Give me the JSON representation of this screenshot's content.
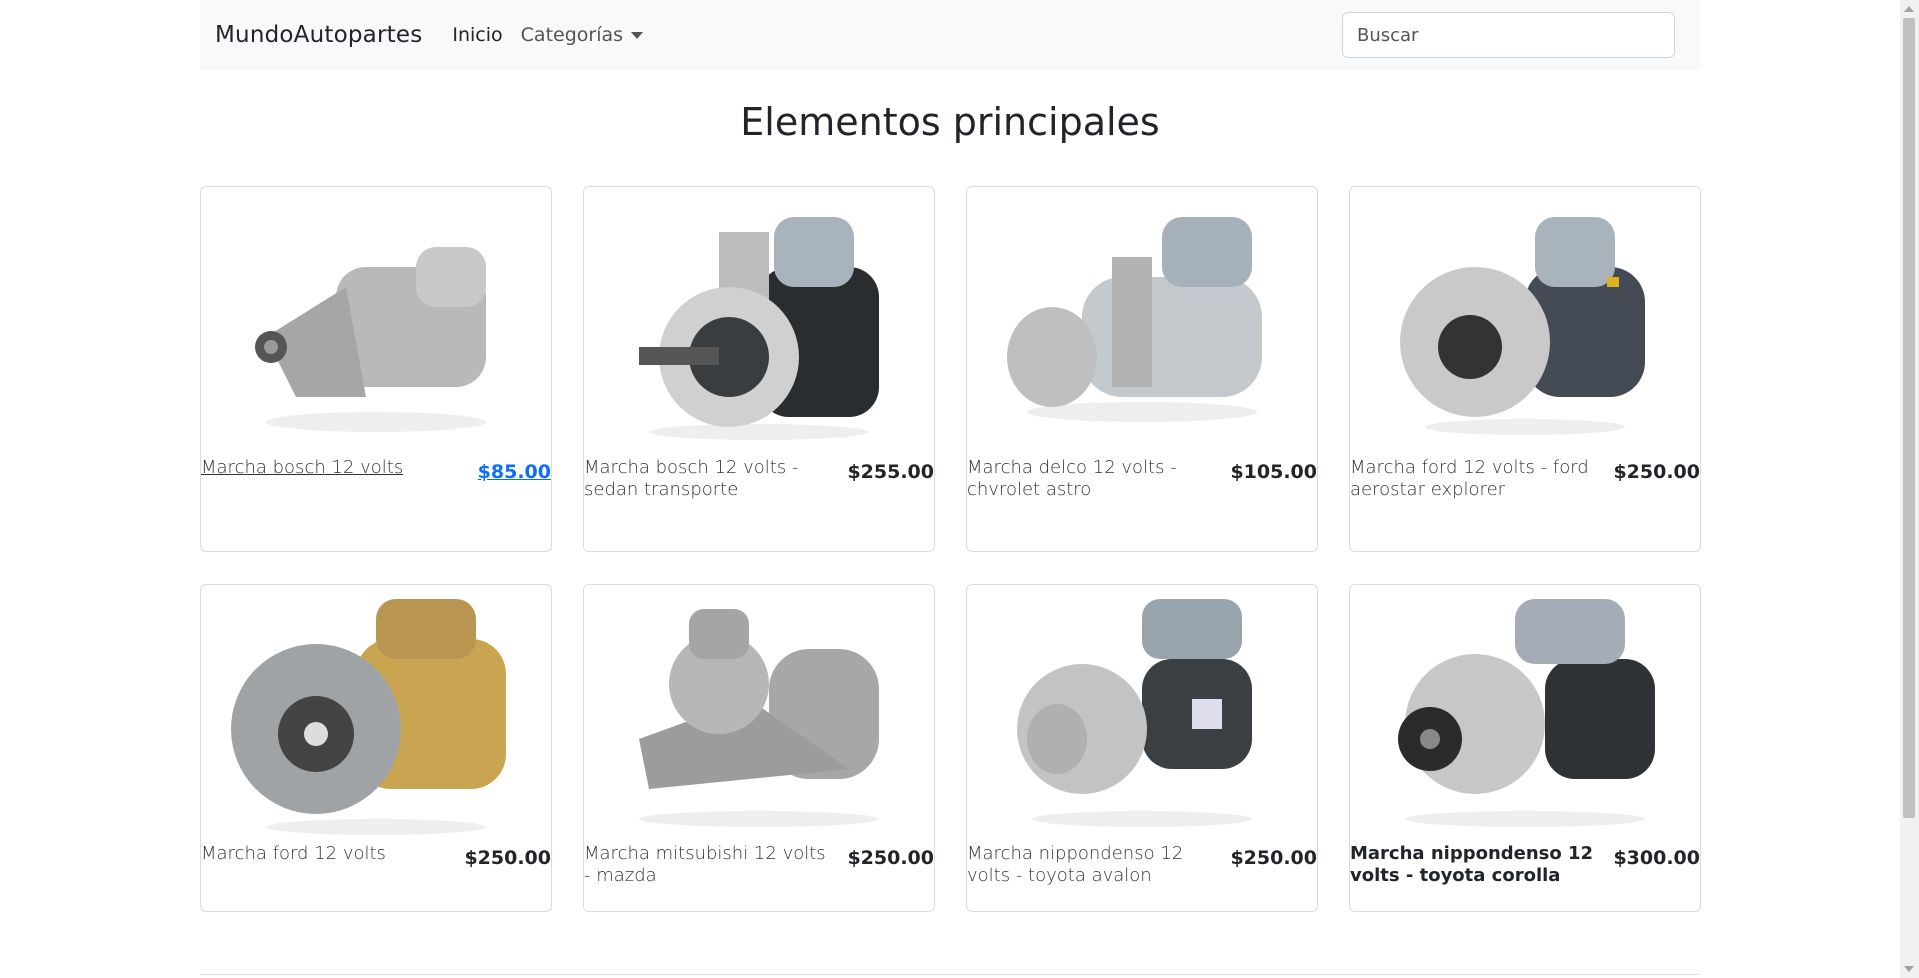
{
  "navbar": {
    "brand": "MundoAutopartes",
    "links": [
      "Inicio",
      "Categorías"
    ],
    "search_placeholder": "Buscar"
  },
  "page": {
    "title": "Elementos principales"
  },
  "products": [
    {
      "name": "Marcha bosch 12 volts",
      "price": "$85.00"
    },
    {
      "name": "Marcha bosch 12 volts - sedan transporte",
      "price": "$255.00"
    },
    {
      "name": "Marcha delco 12 volts - chvrolet astro",
      "price": "$105.00"
    },
    {
      "name": "Marcha ford 12 volts - ford aerostar explorer",
      "price": "$250.00"
    },
    {
      "name": "Marcha ford 12 volts",
      "price": "$250.00"
    },
    {
      "name": "Marcha mitsubishi 12 volts - mazda",
      "price": "$250.00"
    },
    {
      "name": "Marcha nippondenso 12 volts - toyota avalon",
      "price": "$250.00"
    },
    {
      "name": "Marcha nippondenso 12 volts - toyota corolla",
      "price": "$300.00"
    }
  ],
  "colors": {
    "link": "#0d6efd",
    "navbar_bg": "#f8f9fa"
  }
}
